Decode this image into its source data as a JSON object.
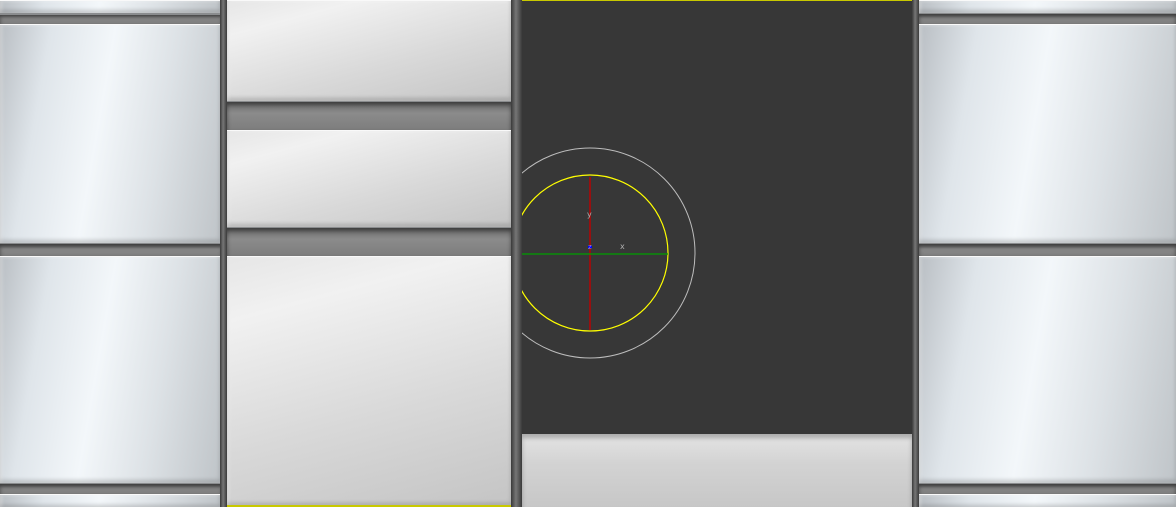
{
  "colors": {
    "viewport_bg": "#373737",
    "selection_highlight": "#ffff00",
    "gizmo_outer_ring": "#c0c0c0",
    "gizmo_inner_ring": "#ffff00",
    "axis_x": "#00a000",
    "axis_y": "#c00000",
    "axis_z": "#0000ff"
  },
  "viewport": {
    "axis_labels": {
      "x": "x",
      "y": "y",
      "z": "z"
    }
  }
}
